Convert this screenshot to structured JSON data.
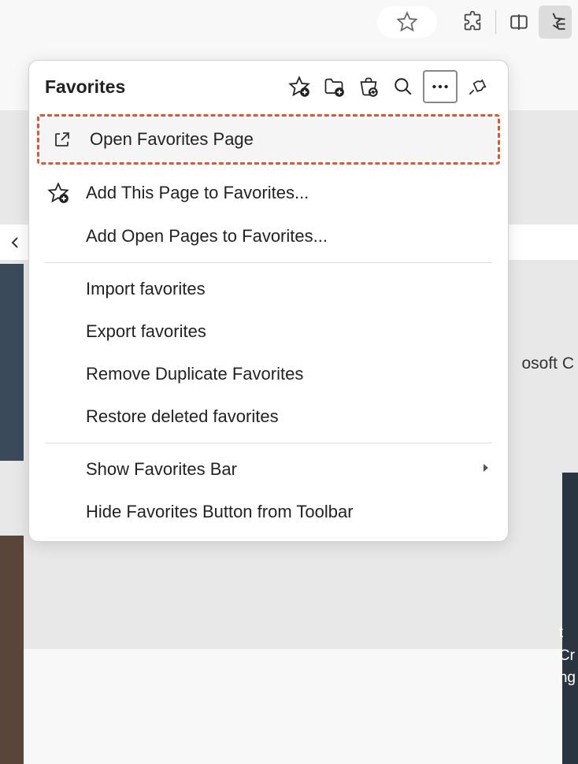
{
  "panel": {
    "title": "Favorites"
  },
  "menu": {
    "open_page": "Open Favorites Page",
    "add_this_page": "Add This Page to Favorites...",
    "add_open_pages": "Add Open Pages to Favorites...",
    "import": "Import favorites",
    "export": "Export favorites",
    "remove_duplicates": "Remove Duplicate Favorites",
    "restore_deleted": "Restore deleted favorites",
    "show_bar": "Show Favorites Bar",
    "hide_button": "Hide Favorites Button from Toolbar"
  },
  "bg": {
    "text1": "osoft C",
    "text2a": "t",
    "text2b": "Cr",
    "text2c": "ng"
  }
}
